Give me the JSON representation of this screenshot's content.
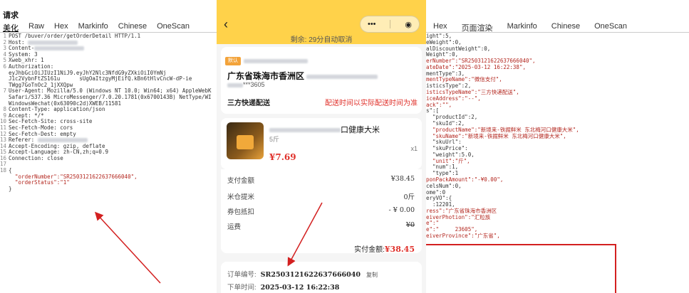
{
  "left": {
    "title": "请求",
    "tabs": [
      "美化",
      "Raw",
      "Hex",
      "Markinfo",
      "Chinese",
      "OneScan"
    ],
    "lines": [
      {
        "n": "1",
        "t": "POST /buver/order/getOrderDetail HTTP/1.1"
      },
      {
        "n": "2",
        "t": "Host: "
      },
      {
        "n": "3",
        "t": "Content-"
      },
      {
        "n": "4",
        "t": "System: 3"
      },
      {
        "n": "5",
        "t": "Xweb_xhr: 1"
      },
      {
        "n": "6",
        "t": "Authorization:"
      },
      {
        "n": "",
        "t": "eyJhbGciOiJIUzI1NiJ9.eyJhY2Nlc3NfdG9yZXkiOiI0YmNj"
      },
      {
        "n": "",
        "t": "J1c2VybnFtZS161u      sUgOaItzgyMjEifQ.kBn6tHlvCncW-dP-ie"
      },
      {
        "n": "",
        "t": "TWgg7GoTnOc2_1jXXQpw"
      },
      {
        "n": "7",
        "t": "User-Agent: Mozilla/5.0 (Windows NT 10.0; Win64; x64) AppleWebK"
      },
      {
        "n": "",
        "t": "Safari/537.36 MicroMessenger/7.0.20.1781(0x6700143B) NetType/WI"
      },
      {
        "n": "",
        "t": "WindowsWechat(0x63090c2d)XWEB/11581"
      },
      {
        "n": "8",
        "t": "Content-Type: application/json"
      },
      {
        "n": "9",
        "t": "Accept: */*"
      },
      {
        "n": "10",
        "t": "Sec-Fetch-Site: cross-site"
      },
      {
        "n": "11",
        "t": "Sec-Fetch-Mode: cors"
      },
      {
        "n": "12",
        "t": "Sec-Fetch-Dest: empty"
      },
      {
        "n": "13",
        "t": "Referer: "
      },
      {
        "n": "14",
        "t": "Accept-Encoding: gzip, deflate"
      },
      {
        "n": "15",
        "t": "Accept-Language: zh-CN,zh;q=0.9"
      },
      {
        "n": "16",
        "t": "Connection: close"
      },
      {
        "n": "17",
        "t": ""
      },
      {
        "n": "18",
        "t": "{"
      },
      {
        "n": "",
        "t": "  \"orderNumber\":\"SR2503121622637666040\","
      },
      {
        "n": "",
        "t": "  \"orderStatus\":\"1\""
      },
      {
        "n": "",
        "t": "}"
      }
    ]
  },
  "right": {
    "tabs": [
      "Hex",
      "页面渲染",
      "Markinfo",
      "Chinese",
      "OneScan"
    ],
    "lines": [
      "ight\":5,",
      "eWeight\":0,",
      "alDiscountWeight\":0,",
      "Weight\":0,",
      "erNumber\":\"SR2503121622637666040\",",
      "ateDate\":\"2025-03-12 16:22:38\",",
      "mentType\":3,",
      "mentTypeName\":\"微信支付\",",
      "isticsType\":2,",
      "isticsTypeName\":\"三方快递配送\",",
      "iceAddress\":\"--\",",
      "ack\":\"\",",
      "s\":[",
      "",
      "  \"productId\":2,",
      "  \"skuId\":2,",
      "  \"productName\":\"新境来-铁掘鲜米 东北梅河口健康大米\",",
      "  \"skuName\":\"新境来-铁掘鲜米 东北梅河口健康大米\",",
      "  \"skuUrl\":",
      "  \"skuPrice\":",
      "  \"weight\":5.0,",
      "  \"unit\":\"斤\",",
      "  \"num\":1,",
      "  \"type\":1",
      "",
      "",
      "ponPackAmount\":\"-¥0.00\",",
      "celsNum\":0,",
      "ome\":0",
      "",
      "eryVO\":{",
      "  :12201,",
      "ress\":\"广东省珠海市香洲区",
      "eiverPhotion\":\"汇粒族",
      "e\":\"",
      "e\":\"     23605\",",
      "eiverProvince\":\"广东省\","
    ]
  },
  "phone": {
    "back_icon": "‹",
    "capsule_more": "•••",
    "capsule_record": "◉",
    "remain": "剩余: 29分自动取消",
    "default_badge": "默认",
    "address": "广东省珠海市香洲区",
    "phone": "***3605",
    "shipping_method": "三方快递配送",
    "shipping_note": "配送时间以实际配送时间为准",
    "product_name": "口健康大米",
    "product_spec": "5斤",
    "product_price": "¥7.69",
    "product_qty": "x1",
    "rows": [
      {
        "label": "支付金额",
        "value": "¥38.45"
      },
      {
        "label": "米仓提米",
        "value": "0斤"
      },
      {
        "label": "券包抵扣",
        "value": "- ¥ 0.00"
      },
      {
        "label": "运费",
        "value": "¥0"
      }
    ],
    "total_label": "实付金额:",
    "total_value": "¥38.45",
    "order_no_label": "订单编号:",
    "order_no": "SR2503121622637666040",
    "copy": "复制",
    "order_time_label": "下单时间:",
    "order_time": "2025-03-12 16:22:38"
  },
  "colors": {
    "header_yellow": "#ffd24a",
    "price_red": "#e0302a",
    "annotation_red": "#d32020"
  }
}
